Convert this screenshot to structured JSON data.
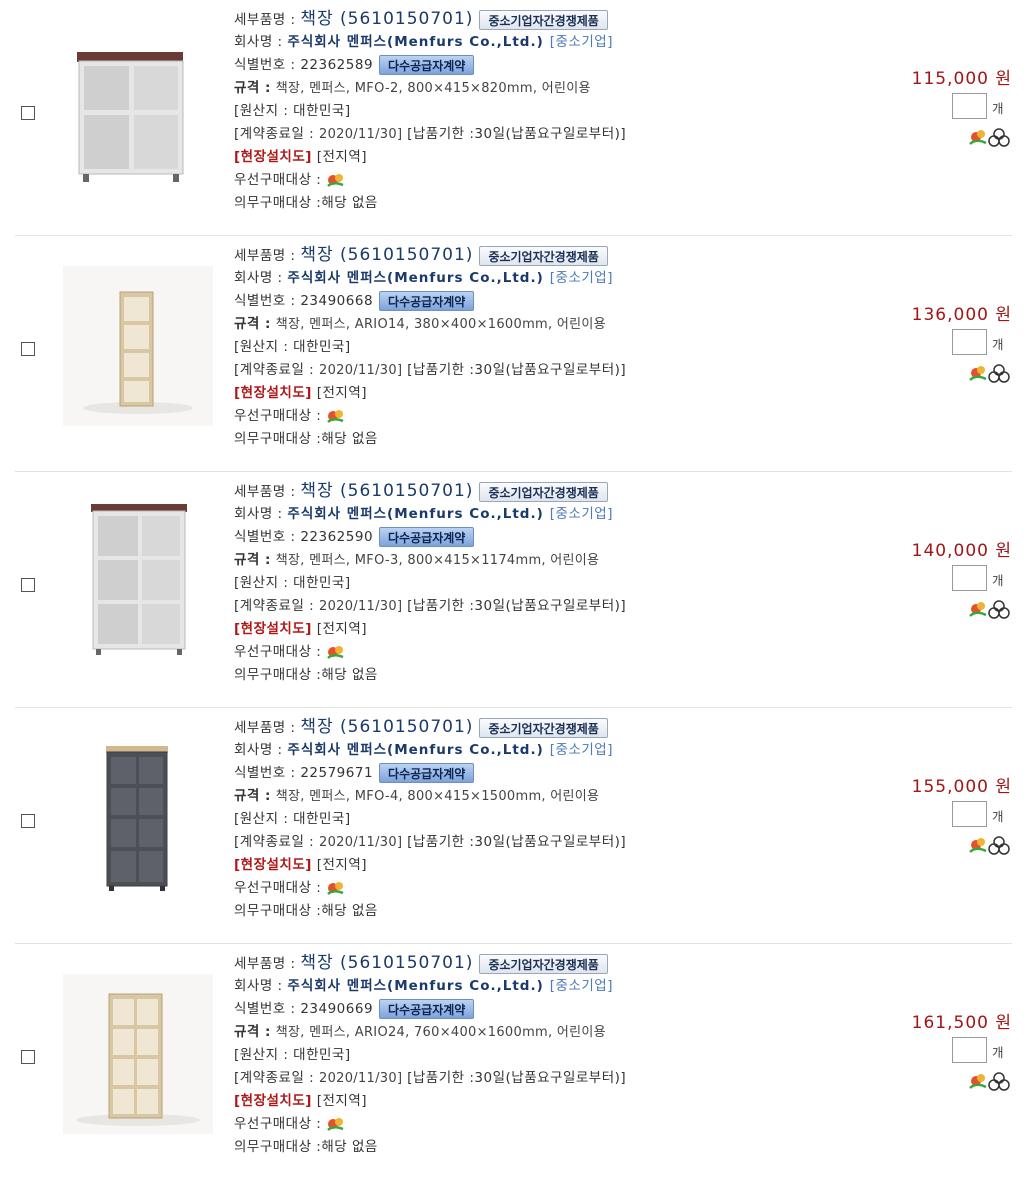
{
  "labels": {
    "detail_name": "세부품명 :",
    "company": "회사명 :",
    "id": "식별번호 :",
    "spec": "규격 :",
    "origin": "[원산지 : 대한민국]",
    "contract_end": "[계약종료일 :",
    "delivery": "[납품기한 :30일(납품요구일로부터)]",
    "install": "[현장설치도]",
    "region": "[전지역]",
    "priority": "우선구매대상 :",
    "mandatory": "의무구매대상 :",
    "mandatory_value": "해당 없음",
    "badge_competition": "중소기업자간경쟁제품",
    "badge_multi": "다수공급자계약",
    "sme_tag": "[중소기업]",
    "qty_unit": "개",
    "contract_end_value": "2020/11/30]"
  },
  "products": [
    {
      "name": "책장 (5610150701)",
      "company": "주식회사 멘퍼스(Menfurs Co.,Ltd.)",
      "id": "22362589",
      "spec": "책장, 멘퍼스, MFO-2, 800×415×820mm, 어린이용",
      "price": "115,000 원",
      "image": "gray-cabinet-2x2"
    },
    {
      "name": "책장 (5610150701)",
      "company": "주식회사 멘퍼스(Menfurs Co.,Ltd.)",
      "id": "23490668",
      "spec": "책장, 멘퍼스, ARIO14, 380×400×1600mm, 어린이용",
      "price": "136,000 원",
      "image": "wood-narrow-shelf"
    },
    {
      "name": "책장 (5610150701)",
      "company": "주식회사 멘퍼스(Menfurs Co.,Ltd.)",
      "id": "22362590",
      "spec": "책장, 멘퍼스, MFO-3, 800×415×1174mm, 어린이용",
      "price": "140,000 원",
      "image": "gray-cabinet-2x3"
    },
    {
      "name": "책장 (5610150701)",
      "company": "주식회사 멘퍼스(Menfurs Co.,Ltd.)",
      "id": "22579671",
      "spec": "책장, 멘퍼스, MFO-4, 800×415×1500mm, 어린이용",
      "price": "155,000 원",
      "image": "dark-cabinet-2x4"
    },
    {
      "name": "책장 (5610150701)",
      "company": "주식회사 멘퍼스(Menfurs Co.,Ltd.)",
      "id": "23490669",
      "spec": "책장, 멘퍼스, ARIO24, 760×400×1600mm, 어린이용",
      "price": "161,500 원",
      "image": "wood-shelf-2x4"
    }
  ],
  "colors": {
    "price": "#a31515",
    "company": "#1a3a6b",
    "install_red": "#b01818"
  }
}
